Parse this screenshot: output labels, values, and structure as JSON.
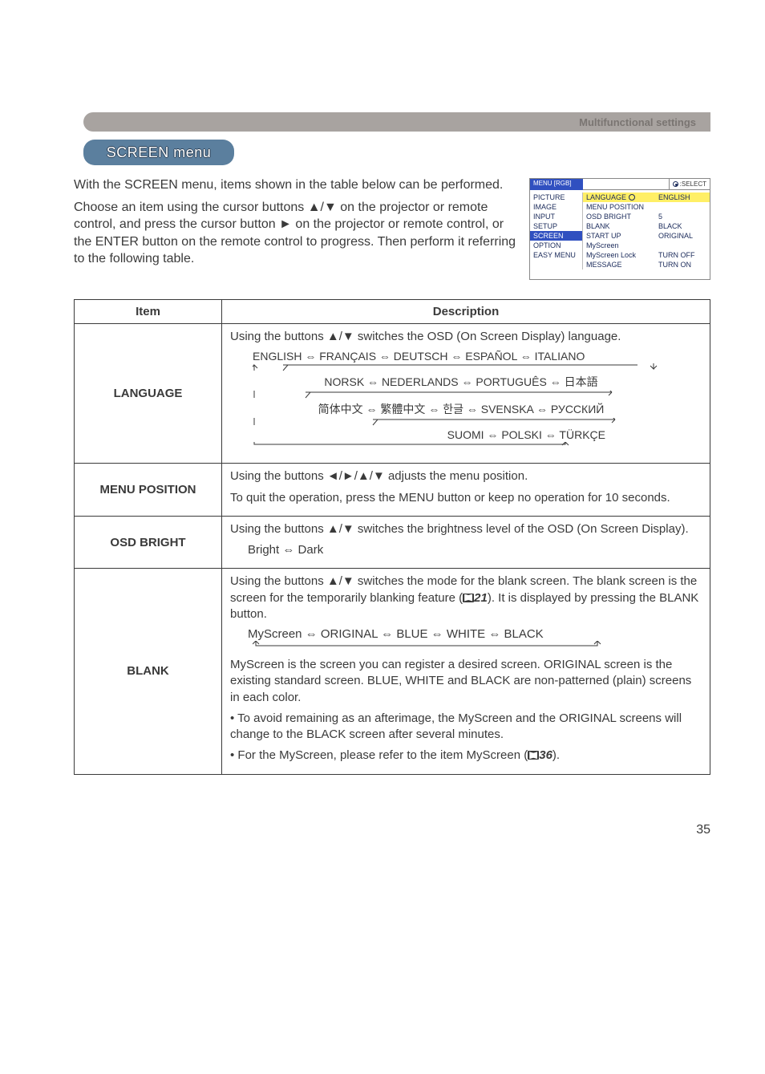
{
  "headerBar": {
    "label": "Multifunctional settings"
  },
  "title": "SCREEN menu",
  "intro": {
    "p1": "With the SCREEN menu, items shown in the table below can be performed.",
    "p2": "Choose an item using the cursor buttons ▲/▼ on the projector or remote control, and press the cursor button ► on the projector or remote control, or the ENTER button on the remote control to progress. Then perform it referring to the following table."
  },
  "osd": {
    "titleLeft": "MENU [RGB]",
    "titleRight": ":SELECT",
    "col1": [
      "PICTURE",
      "IMAGE",
      "INPUT",
      "SETUP",
      "SCREEN",
      "OPTION",
      "EASY MENU"
    ],
    "col2": [
      "LANGUAGE",
      "MENU POSITION",
      "OSD BRIGHT",
      "BLANK",
      "START UP",
      "MyScreen",
      "MyScreen Lock",
      "MESSAGE"
    ],
    "col3": [
      "ENGLISH",
      "",
      "5",
      "BLACK",
      "ORIGINAL",
      "",
      "TURN OFF",
      "TURN ON"
    ]
  },
  "table": {
    "headItem": "Item",
    "headDesc": "Description",
    "rows": {
      "language": {
        "item": "LANGUAGE",
        "p1": "Using the buttons ▲/▼ switches the OSD (On Screen Display) language.",
        "line1": "ENGLISH ⇔ FRANÇAIS ⇔ DEUTSCH ⇔ ESPAÑOL ⇔ ITALIANO",
        "line2": "NORSK ⇔ NEDERLANDS ⇔ PORTUGUÊS ⇔ 日本語",
        "line3": "简体中文 ⇔ 繁體中文 ⇔ 한글 ⇔ SVENSKA ⇔ РУССКИЙ",
        "line4": "SUOMI ⇔ POLSKI ⇔ TÜRKÇE"
      },
      "menuPosition": {
        "item": "MENU POSITION",
        "p1": "Using the buttons ◄/►/▲/▼ adjusts the menu position.",
        "p2": "To quit the operation, press the MENU button or keep no operation for 10 seconds."
      },
      "osdBright": {
        "item": "OSD BRIGHT",
        "p1": "Using the buttons ▲/▼ switches the brightness level of the OSD (On Screen Display).",
        "p2": "Bright ⇔ Dark"
      },
      "blank": {
        "item": "BLANK",
        "p1a": "Using the buttons ▲/▼ switches the mode for the blank screen. The blank screen is the screen for the temporarily blanking feature (",
        "p1ref": "21",
        "p1b": "). It is displayed by pressing the BLANK button.",
        "modes": "MyScreen ⇔ ORIGINAL ⇔ BLUE ⇔ WHITE ⇔ BLACK",
        "p2": "MyScreen is the screen you can register a desired screen. ORIGINAL screen is the existing standard screen. BLUE, WHITE and BLACK are non-patterned (plain) screens in each color.",
        "p3": "• To avoid remaining as an afterimage, the MyScreen and the ORIGINAL screens will change to the BLACK screen after several minutes.",
        "p4a": "• For the MyScreen, please refer to the item MyScreen (",
        "p4ref": "36",
        "p4b": ")."
      }
    }
  },
  "pageNumber": "35"
}
